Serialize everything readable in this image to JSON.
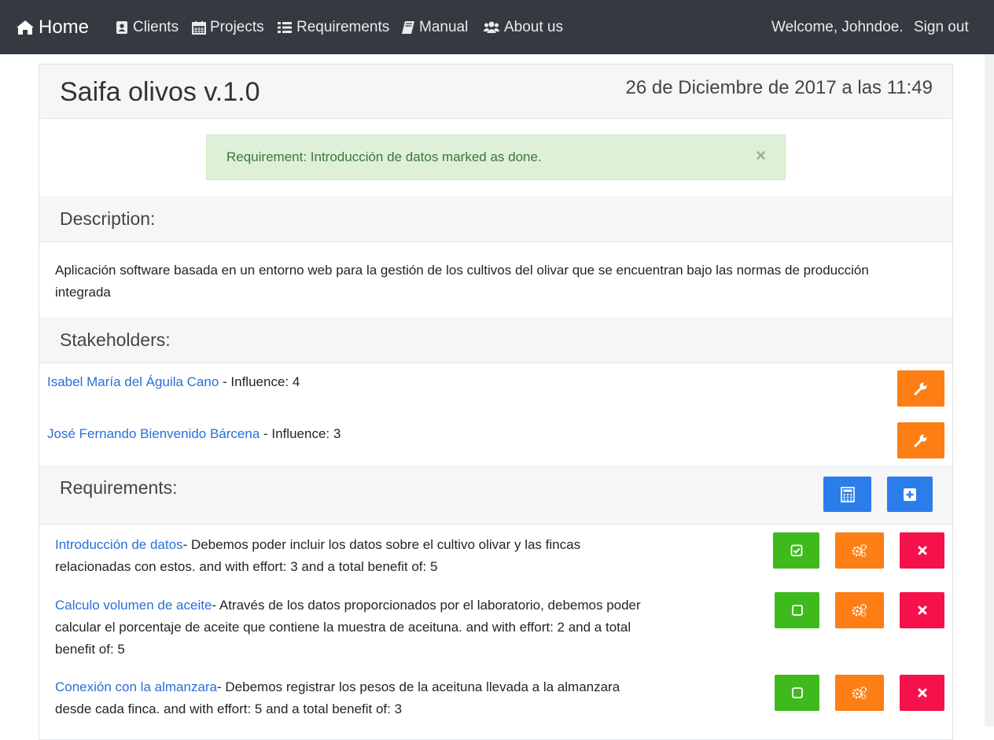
{
  "nav": {
    "brand": "Home",
    "items": [
      {
        "label": "Clients",
        "icon": "address-card-icon"
      },
      {
        "label": "Projects",
        "icon": "calendar-icon"
      },
      {
        "label": "Requirements",
        "icon": "list-icon"
      },
      {
        "label": "Manual",
        "icon": "book-icon"
      },
      {
        "label": "About us",
        "icon": "users-icon"
      }
    ],
    "welcome": "Welcome, Johndoe.",
    "signout": "Sign out"
  },
  "project": {
    "title": "Saifa olivos v.1.0",
    "date": "26 de Diciembre de 2017 a las 11:49"
  },
  "alert": {
    "message": "Requirement: Introducción de datos marked as done.",
    "close": "×"
  },
  "description": {
    "heading": "Description:",
    "text": "Aplicación software basada en un entorno web para la gestión de los cultivos del olivar que se encuentran bajo las normas de producción integrada"
  },
  "stakeholders": {
    "heading": "Stakeholders:",
    "items": [
      {
        "name": "Isabel María del Águila Cano",
        "influence": " - Influence: 4"
      },
      {
        "name": "José Fernando Bienvenido Bárcena",
        "influence": " - Influence: 3"
      }
    ]
  },
  "requirements": {
    "heading": "Requirements:",
    "items": [
      {
        "name": "Introducción de datos",
        "text": "- Debemos poder incluir los datos sobre el cultivo olivar y las fincas relacionadas con estos. and with effort: 3 and a total benefit of: 5",
        "done": true
      },
      {
        "name": "Calculo volumen de aceite",
        "text": "- Através de los datos proporcionados por el laboratorio, debemos poder calcular el porcentaje de aceite que contiene la muestra de aceituna. and with effort: 2 and a total benefit of: 5",
        "done": false
      },
      {
        "name": "Conexión con la almanzara",
        "text": "- Debemos registrar los pesos de la aceituna llevada a la almanzara desde cada finca. and with effort: 5 and a total benefit of: 3",
        "done": false
      }
    ]
  },
  "colors": {
    "navbar": "#343a40",
    "link": "#2a6fd6",
    "orange": "#fd7e14",
    "blue": "#2b7de9",
    "green": "#3fba1d",
    "red": "#f5124a",
    "alert_bg": "#dff0d8",
    "alert_text": "#3c763d"
  }
}
